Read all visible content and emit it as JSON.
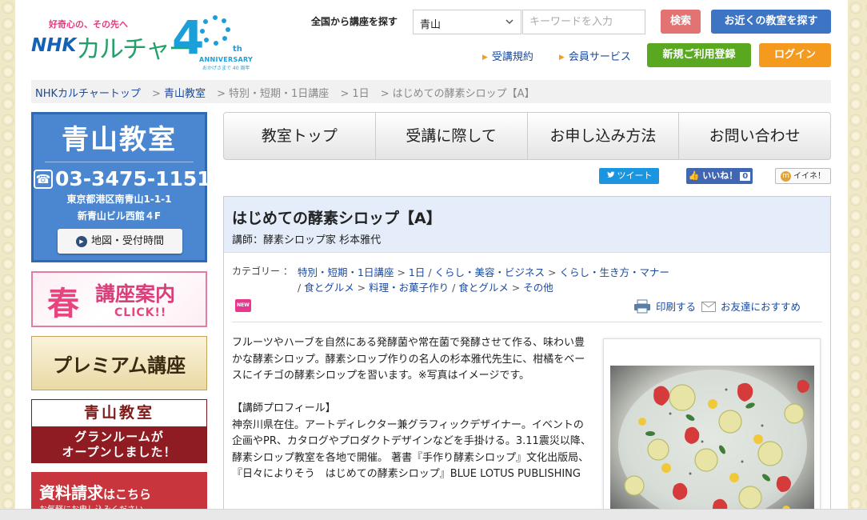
{
  "header": {
    "logo": {
      "tagline": "好奇心の、その先へ",
      "brand_nhk": "NHK",
      "brand_culture": "カルチャー",
      "anniv_number": "4",
      "anniv_th": "th",
      "anniv_word": "ANNIVERSARY",
      "anniv_sub": "おかげさまで 40 周年"
    },
    "search": {
      "label": "全国から講座を探す",
      "area_selected": "青山",
      "keyword_placeholder": "キーワードを入力",
      "search_button": "検索",
      "nearby_button": "お近くの教室を探す"
    },
    "links": {
      "terms": "受講規約",
      "member": "会員サービス"
    },
    "register_button": "新規ご利用登録",
    "login_button": "ログイン"
  },
  "breadcrumb": {
    "items": [
      "NHKカルチャートップ",
      "青山教室",
      "特別・短期・1日講座",
      "1日",
      "はじめての酵素シロップ【A】"
    ],
    "separator": ">"
  },
  "sidebar": {
    "classroom_name": "青山教室",
    "phone": "03-3475-1151",
    "address_line1": "東京都港区南青山1-1-1",
    "address_line2": "新青山ビル西館４F",
    "map_button": "地図・受付時間",
    "spring_banner": {
      "haru": "春",
      "title": "講座案内",
      "click": "CLICK!!"
    },
    "premium_banner": "プレミアム講座",
    "grand_banner": {
      "top": "青山教室",
      "line1": "グランルームが",
      "line2": "オープンしました！"
    },
    "request_banner": {
      "title": "資料請求",
      "title_small": "はこちら",
      "sub": "お気軽にお申し込みください"
    }
  },
  "main_nav": {
    "tabs": [
      "教室トップ",
      "受講に際して",
      "お申し込み方法",
      "お問い合わせ"
    ]
  },
  "social": {
    "tweet": "ツイート",
    "like": "いいね！",
    "like_count": "0",
    "iine": "イイネ！"
  },
  "course": {
    "title": "はじめての酵素シロップ【A】",
    "instructor": "講師：酵素シロップ家 杉本雅代",
    "category_label": "カテゴリー ：",
    "categories_line1": [
      "特別・短期・1日講座",
      "1日",
      "くらし・美容・ビジネス",
      "くらし・生き方・マナー"
    ],
    "categories_line2": [
      "食とグルメ",
      "料理・お菓子作り",
      "食とグルメ",
      "その他"
    ],
    "new_badge": "NEW",
    "print_link": "印刷する",
    "share_link": "お友達におすすめ",
    "description": "フルーツやハーブを自然にある発酵菌や常在菌で発酵させて作る、味わい豊かな酵素シロップ。酵素シロップ作りの名人の杉本雅代先生に、柑橘をベースにイチゴの酵素シロップを習います。※写真はイメージです。",
    "profile_heading": "【講師プロフィール】",
    "profile_text": "神奈川県在住。アートディレクター兼グラフィックデザイナー。イベントの企画やPR、カタログやプロダクトデザインなどを手掛ける。3.11震災以降、酵素シロップ教室を各地で開催。 著書『手作り酵素シロップ』文化出版局、『日々によりそう　はじめての酵素シロップ』BLUE LOTUS PUBLISHING"
  },
  "colors": {
    "accent_blue": "#3d75c4",
    "search_red": "#e37373",
    "register_green": "#5aa820",
    "login_orange": "#f39a1f",
    "link_blue": "#1a4aa0",
    "course_header_bg": "#e4edf9"
  },
  "icons": [
    "phone-icon",
    "play-icon",
    "print-icon",
    "mail-icon",
    "chevron-down-icon",
    "arrow-right-icon",
    "twitter-icon",
    "facebook-like-icon",
    "mixi-icon"
  ]
}
